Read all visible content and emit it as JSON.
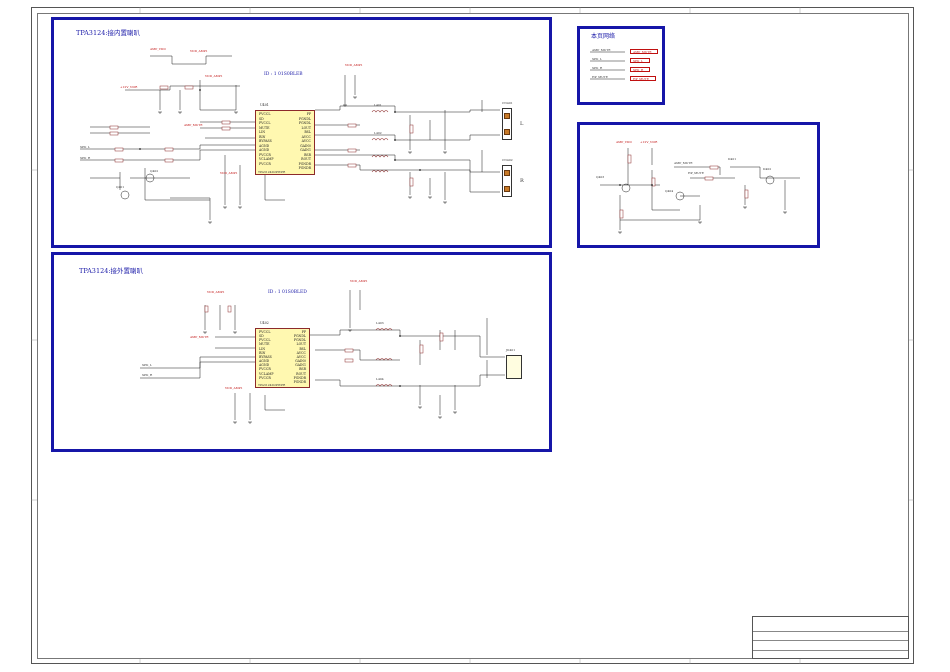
{
  "sections": {
    "internal": {
      "title": "TPA3124:接内置喇叭",
      "id_note": "ID : 1 01S0BLEB"
    },
    "external": {
      "title": "TPA3124:接外置喇叭",
      "id_note": "ID : 1 01S0BLED"
    },
    "network": {
      "title": "本页网络"
    },
    "mute": {
      "title": ""
    }
  },
  "network_labels": [
    {
      "left": "AMP_MUTE",
      "right": "AMP_MUTE"
    },
    {
      "left": "SPK_L",
      "right": "SPK_L"
    },
    {
      "left": "SPK_R",
      "right": "SPK_R"
    },
    {
      "left": "HP_MUTE",
      "right": "HP_MUTE"
    }
  ],
  "power_nets": {
    "vdd": "VDD_AMP1",
    "vdd_alt": "AMP_VDD",
    "v12": "+12V_NOR",
    "amp_mute": "AMP_MUTE",
    "spk_l": "SPK_L",
    "spk_r": "SPK_R",
    "hp_mute": "HP_MUTE"
  },
  "ic_internal": {
    "refdes": "U401",
    "part": "TPA3124D2PWPR",
    "left_pins": [
      "PVCCL",
      "SD",
      "PVCCL",
      "MUTE",
      "LIN",
      "RIN",
      "BYPASS",
      "AGND",
      "AGND",
      "PVCCR",
      "VCLAMP",
      "PVCCR"
    ],
    "right_pins": [
      "PP",
      "PGNDL",
      "PGNDL",
      "LOUT",
      "BSL",
      "AVCC",
      "AVCC",
      "GAIN0",
      "GAIN1",
      "BSR",
      "ROUT",
      "PGNDR",
      "PGNDR"
    ]
  },
  "ic_external": {
    "refdes": "U402",
    "part": "TPA3124D2PWPR",
    "left_pins": [
      "PVCCL",
      "SD",
      "PVCCL",
      "MUTE",
      "LIN",
      "RIN",
      "BYPASS",
      "AGND",
      "AGND",
      "PVCCR",
      "VCLAMP",
      "PVCCR"
    ],
    "right_pins": [
      "PP",
      "PGNDL",
      "PGNDL",
      "LOUT",
      "BSL",
      "AVCC",
      "AVCC",
      "GAIN0",
      "GAIN1",
      "BSR",
      "ROUT",
      "PGNDR",
      "PGNDR"
    ]
  },
  "connectors": {
    "left_speaker": {
      "label": "CN401",
      "side": "L"
    },
    "right_speaker": {
      "label": "CN402",
      "side": "R"
    },
    "ext_jack": {
      "label": "JK401"
    }
  },
  "parts": {
    "l401": "L401",
    "l402": "L402",
    "l403": "L403",
    "l404": "L404",
    "q401": "Q401",
    "q402": "Q402",
    "q403": "Q403",
    "q404": "Q404",
    "d401": "D401",
    "d402": "D402",
    "d403": "D403",
    "c_big1": "470uF",
    "c_big2": "470uF"
  },
  "title_block": {
    "company": "",
    "title": "",
    "doc": "",
    "size": "",
    "rev": "",
    "sheet": ""
  }
}
